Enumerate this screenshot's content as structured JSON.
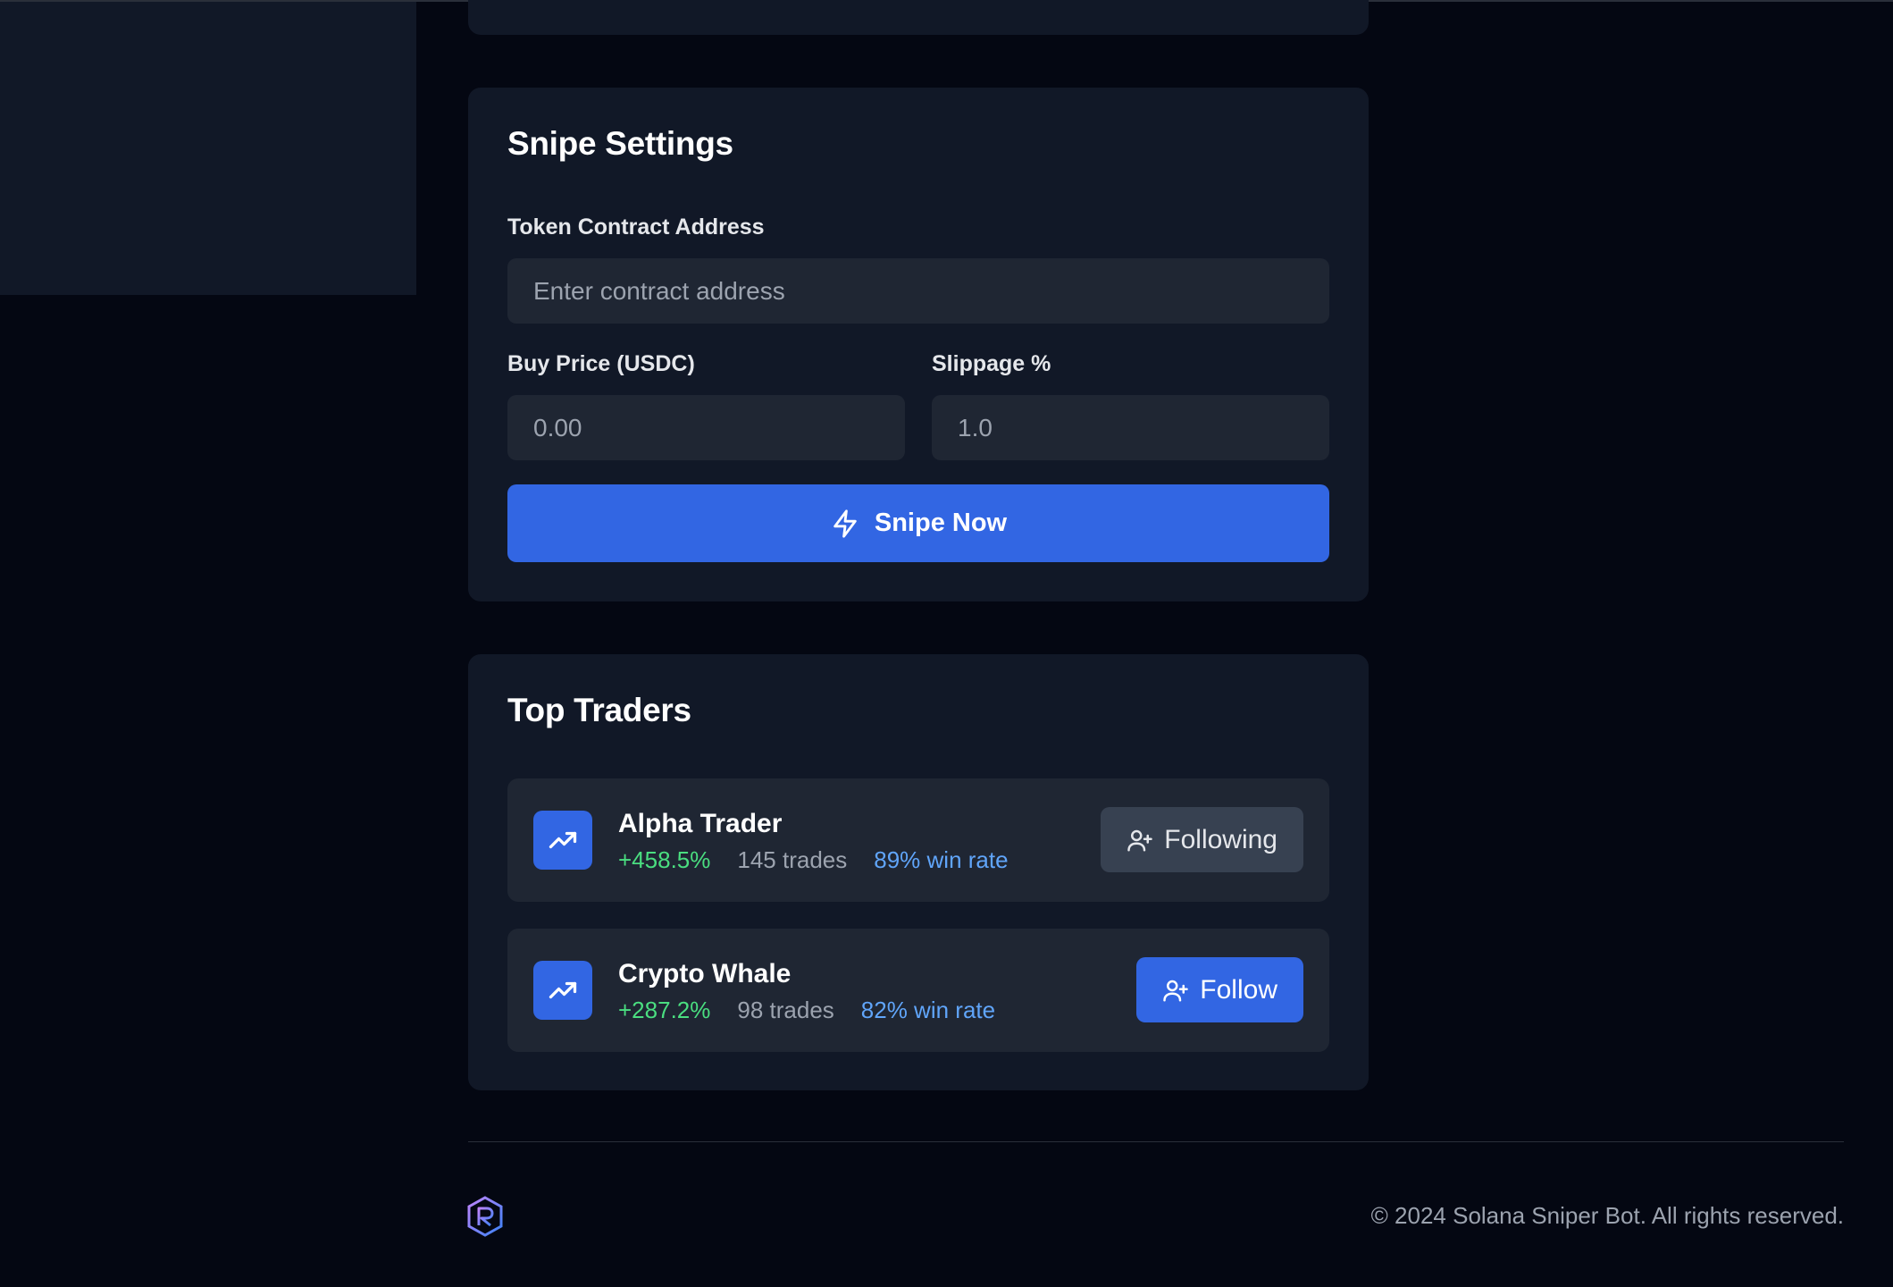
{
  "snipe_settings": {
    "title": "Snipe Settings",
    "token_label": "Token Contract Address",
    "token_placeholder": "Enter contract address",
    "buy_price_label": "Buy Price (USDC)",
    "buy_price_placeholder": "0.00",
    "slippage_label": "Slippage %",
    "slippage_placeholder": "1.0",
    "snipe_button": "Snipe Now",
    "snipe_icon": "lightning-icon"
  },
  "top_traders": {
    "title": "Top Traders",
    "traders": [
      {
        "name": "Alpha Trader",
        "gain": "+458.5%",
        "trades": "145 trades",
        "win_rate": "89% win rate",
        "action": "Following",
        "icon": "trending-up-icon"
      },
      {
        "name": "Crypto Whale",
        "gain": "+287.2%",
        "trades": "98 trades",
        "win_rate": "82% win rate",
        "action": "Follow",
        "icon": "trending-up-icon"
      }
    ]
  },
  "footer": {
    "copyright": "© 2024 Solana Sniper Bot. All rights reserved.",
    "logo_icon": "hexagon-logo-icon"
  },
  "colors": {
    "background": "#040712",
    "card": "#111827",
    "input": "#1f2633",
    "accent": "#3266e3",
    "gain": "#4ade80",
    "win_rate": "#60a5fa",
    "muted": "#9ca3af"
  }
}
